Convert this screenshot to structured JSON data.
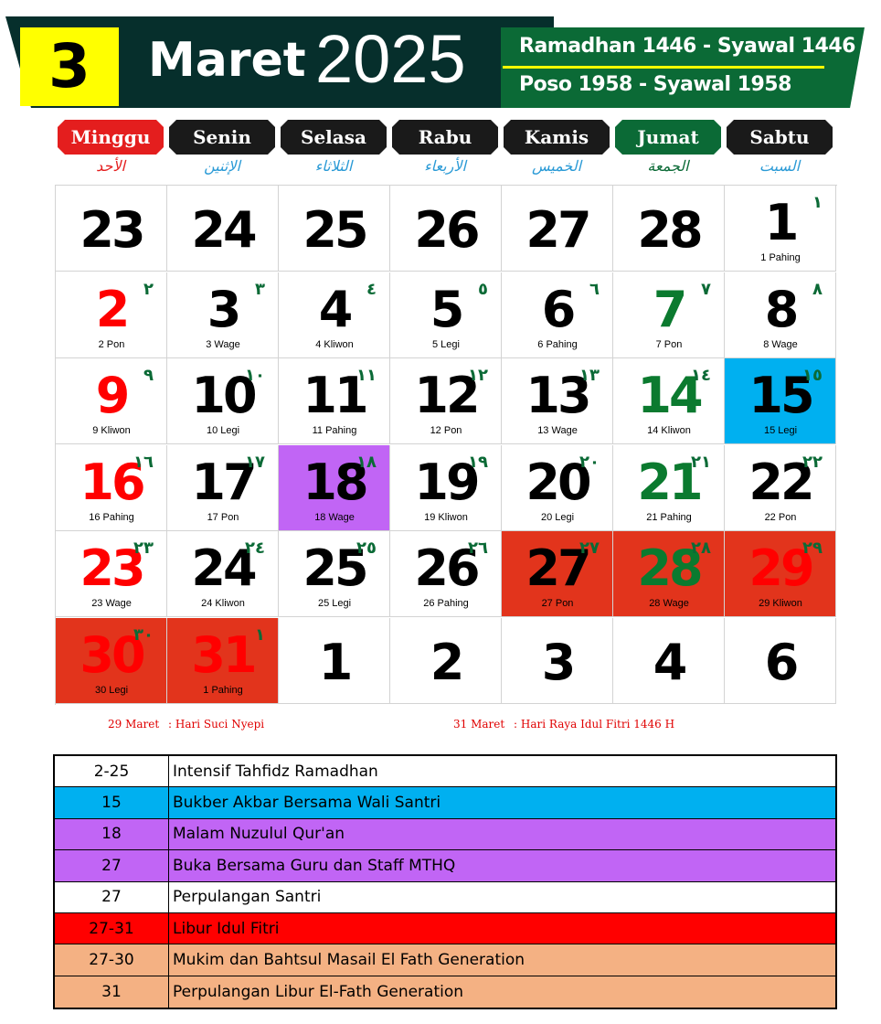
{
  "header": {
    "month_number": "3",
    "month": "Maret",
    "year": "2025",
    "hijri": "Ramadhan 1446 - Syawal 1446",
    "poso": "Poso 1958 - Syawal 1958"
  },
  "colors": {
    "dark_header": "#062f2c",
    "green_header": "#0b6a36",
    "yellow": "#ffff00",
    "red": "#ff0000",
    "green_text": "#0b7a2f",
    "holiday_red": "#e2341c",
    "blue_event": "#00b0f0",
    "purple_event": "#c165f5",
    "peach_event": "#f4b183"
  },
  "days": [
    {
      "name": "Minggu",
      "arabic": "الأحد",
      "bg": "#e41e1e",
      "arabic_color": "#e41e1e"
    },
    {
      "name": "Senin",
      "arabic": "الإثنين",
      "bg": "#1a1a1a",
      "arabic_color": "#2a9ad6"
    },
    {
      "name": "Selasa",
      "arabic": "الثلاثاء",
      "bg": "#1a1a1a",
      "arabic_color": "#2a9ad6"
    },
    {
      "name": "Rabu",
      "arabic": "الأربعاء",
      "bg": "#1a1a1a",
      "arabic_color": "#2a9ad6"
    },
    {
      "name": "Kamis",
      "arabic": "الخميس",
      "bg": "#1a1a1a",
      "arabic_color": "#2a9ad6"
    },
    {
      "name": "Jumat",
      "arabic": "الجمعة",
      "bg": "#0b6a36",
      "arabic_color": "#0b6a36"
    },
    {
      "name": "Sabtu",
      "arabic": "السبت",
      "bg": "#1a1a1a",
      "arabic_color": "#2a9ad6"
    }
  ],
  "weeks": [
    [
      {
        "day": "23",
        "hijri": "",
        "pasaran": "",
        "color": "#000",
        "bg": ""
      },
      {
        "day": "24",
        "hijri": "",
        "pasaran": "",
        "color": "#000",
        "bg": ""
      },
      {
        "day": "25",
        "hijri": "",
        "pasaran": "",
        "color": "#000",
        "bg": ""
      },
      {
        "day": "26",
        "hijri": "",
        "pasaran": "",
        "color": "#000",
        "bg": ""
      },
      {
        "day": "27",
        "hijri": "",
        "pasaran": "",
        "color": "#000",
        "bg": ""
      },
      {
        "day": "28",
        "hijri": "",
        "pasaran": "",
        "color": "#000",
        "bg": ""
      },
      {
        "day": "1",
        "hijri": "١",
        "pasaran": "1 Pahing",
        "color": "#000",
        "bg": ""
      }
    ],
    [
      {
        "day": "2",
        "hijri": "٢",
        "pasaran": "2 Pon",
        "color": "#ff0000",
        "bg": ""
      },
      {
        "day": "3",
        "hijri": "٣",
        "pasaran": "3 Wage",
        "color": "#000",
        "bg": ""
      },
      {
        "day": "4",
        "hijri": "٤",
        "pasaran": "4 Kliwon",
        "color": "#000",
        "bg": ""
      },
      {
        "day": "5",
        "hijri": "٥",
        "pasaran": "5 Legi",
        "color": "#000",
        "bg": ""
      },
      {
        "day": "6",
        "hijri": "٦",
        "pasaran": "6 Pahing",
        "color": "#000",
        "bg": ""
      },
      {
        "day": "7",
        "hijri": "٧",
        "pasaran": "7 Pon",
        "color": "#0b7a2f",
        "bg": ""
      },
      {
        "day": "8",
        "hijri": "٨",
        "pasaran": "8 Wage",
        "color": "#000",
        "bg": ""
      }
    ],
    [
      {
        "day": "9",
        "hijri": "٩",
        "pasaran": "9 Kliwon",
        "color": "#ff0000",
        "bg": ""
      },
      {
        "day": "10",
        "hijri": "١٠",
        "pasaran": "10 Legi",
        "color": "#000",
        "bg": ""
      },
      {
        "day": "11",
        "hijri": "١١",
        "pasaran": "11 Pahing",
        "color": "#000",
        "bg": ""
      },
      {
        "day": "12",
        "hijri": "١٢",
        "pasaran": "12 Pon",
        "color": "#000",
        "bg": ""
      },
      {
        "day": "13",
        "hijri": "١٣",
        "pasaran": "13 Wage",
        "color": "#000",
        "bg": ""
      },
      {
        "day": "14",
        "hijri": "١٤",
        "pasaran": "14 Kliwon",
        "color": "#0b7a2f",
        "bg": ""
      },
      {
        "day": "15",
        "hijri": "١٥",
        "pasaran": "15 Legi",
        "color": "#000",
        "bg": "#00b0f0"
      }
    ],
    [
      {
        "day": "16",
        "hijri": "١٦",
        "pasaran": "16 Pahing",
        "color": "#ff0000",
        "bg": ""
      },
      {
        "day": "17",
        "hijri": "١٧",
        "pasaran": "17 Pon",
        "color": "#000",
        "bg": ""
      },
      {
        "day": "18",
        "hijri": "١٨",
        "pasaran": "18 Wage",
        "color": "#000",
        "bg": "#c165f5"
      },
      {
        "day": "19",
        "hijri": "١٩",
        "pasaran": "19 Kliwon",
        "color": "#000",
        "bg": ""
      },
      {
        "day": "20",
        "hijri": "٢٠",
        "pasaran": "20 Legi",
        "color": "#000",
        "bg": ""
      },
      {
        "day": "21",
        "hijri": "٢١",
        "pasaran": "21 Pahing",
        "color": "#0b7a2f",
        "bg": ""
      },
      {
        "day": "22",
        "hijri": "٢٢",
        "pasaran": "22 Pon",
        "color": "#000",
        "bg": ""
      }
    ],
    [
      {
        "day": "23",
        "hijri": "٢٣",
        "pasaran": "23 Wage",
        "color": "#ff0000",
        "bg": ""
      },
      {
        "day": "24",
        "hijri": "٢٤",
        "pasaran": "24 Kliwon",
        "color": "#000",
        "bg": ""
      },
      {
        "day": "25",
        "hijri": "٢٥",
        "pasaran": "25 Legi",
        "color": "#000",
        "bg": ""
      },
      {
        "day": "26",
        "hijri": "٢٦",
        "pasaran": "26 Pahing",
        "color": "#000",
        "bg": ""
      },
      {
        "day": "27",
        "hijri": "٢٧",
        "pasaran": "27 Pon",
        "color": "#000",
        "bg": "#e2341c"
      },
      {
        "day": "28",
        "hijri": "٢٨",
        "pasaran": "28 Wage",
        "color": "#0b7a2f",
        "bg": "#e2341c"
      },
      {
        "day": "29",
        "hijri": "٢٩",
        "pasaran": "29 Kliwon",
        "color": "#ff0000",
        "bg": "#e2341c"
      }
    ],
    [
      {
        "day": "30",
        "hijri": "٣٠",
        "pasaran": "30 Legi",
        "color": "#ff0000",
        "bg": "#e2341c"
      },
      {
        "day": "31",
        "hijri": "١",
        "pasaran": "1 Pahing",
        "color": "#ff0000",
        "bg": "#e2341c"
      },
      {
        "day": "1",
        "hijri": "",
        "pasaran": "",
        "color": "#000",
        "bg": ""
      },
      {
        "day": "2",
        "hijri": "",
        "pasaran": "",
        "color": "#000",
        "bg": ""
      },
      {
        "day": "3",
        "hijri": "",
        "pasaran": "",
        "color": "#000",
        "bg": ""
      },
      {
        "day": "4",
        "hijri": "",
        "pasaran": "",
        "color": "#000",
        "bg": ""
      },
      {
        "day": "6",
        "hijri": "",
        "pasaran": "",
        "color": "#000",
        "bg": ""
      }
    ]
  ],
  "notes": [
    {
      "date": "29 Maret",
      "text": ": Hari Suci Nyepi"
    },
    {
      "date": "31 Maret",
      "text": ": Hari Raya Idul Fitri 1446 H"
    }
  ],
  "events": [
    {
      "date": "2-25",
      "text": "Intensif  Tahfidz  Ramadhan",
      "bg": "#ffffff",
      "text_bg": "#ffffff"
    },
    {
      "date": "15",
      "text": "Bukber Akbar Bersama Wali Santri",
      "bg": "#00b0f0",
      "text_bg": "#00b0f0"
    },
    {
      "date": "18",
      "text": "Malam Nuzulul Qur'an",
      "bg": "#c165f5",
      "text_bg": "#c165f5"
    },
    {
      "date": "27",
      "text": "Buka Bersama Guru dan Staff MTHQ",
      "bg": "#c165f5",
      "text_bg": "#c165f5"
    },
    {
      "date": "27",
      "text": "Perpulangan Santri",
      "bg": "#ffffff",
      "text_bg": "#ffffff"
    },
    {
      "date": "27-31",
      "text": "Libur Idul Fitri",
      "bg": "#ff0000",
      "text_bg": "#ff0000"
    },
    {
      "date": "27-30",
      "text": "Mukim dan Bahtsul Masail El Fath Generation",
      "bg": "#f4b183",
      "text_bg": "#f4b183"
    },
    {
      "date": "31",
      "text": "Perpulangan Libur El-Fath Generation",
      "bg": "#f4b183",
      "text_bg": "#f4b183"
    }
  ]
}
